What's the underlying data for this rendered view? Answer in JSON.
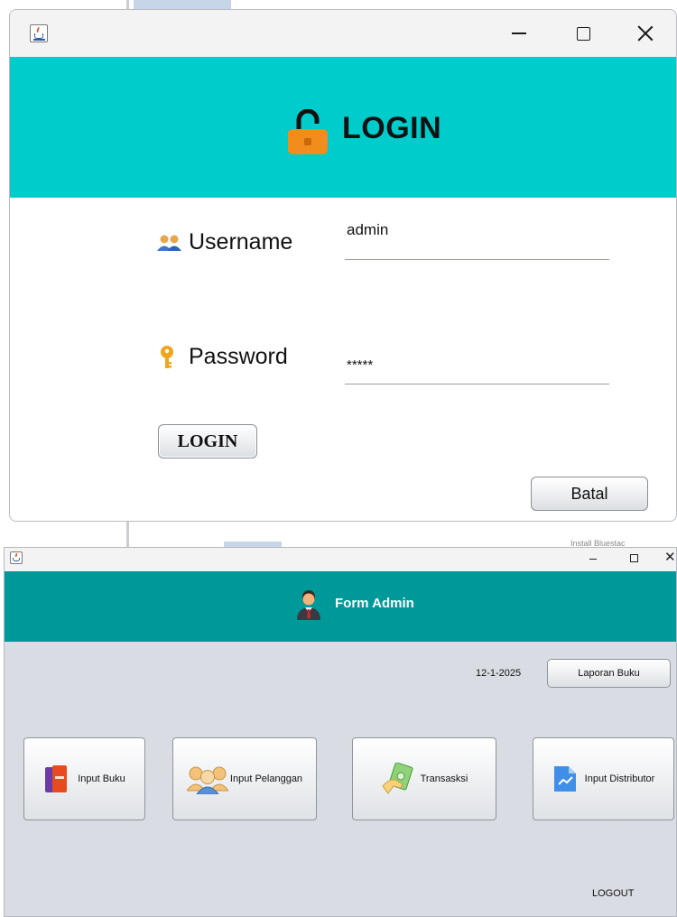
{
  "login_window": {
    "heading": "LOGIN",
    "username_label": "Username",
    "username_value": "admin",
    "password_label": "Password",
    "password_value": "*****",
    "login_button": "LOGIN",
    "cancel_button": "Batal",
    "colors": {
      "header": "#00cccc",
      "lock": "#f28c1c"
    }
  },
  "admin_window": {
    "heading": "Form Admin",
    "date": "12-1-2025",
    "report_button": "Laporan Buku",
    "tiles": [
      {
        "label": "Input Buku",
        "icon": "books-icon"
      },
      {
        "label": "Input Pelanggan",
        "icon": "customers-icon"
      },
      {
        "label": "Transasksi",
        "icon": "money-hand-icon"
      },
      {
        "label": "Input Distributor",
        "icon": "chart-document-icon"
      }
    ],
    "logout": "LOGOUT",
    "background_caption": "Install Bluestac",
    "colors": {
      "header": "#009999",
      "body": "#d9dde3"
    }
  }
}
